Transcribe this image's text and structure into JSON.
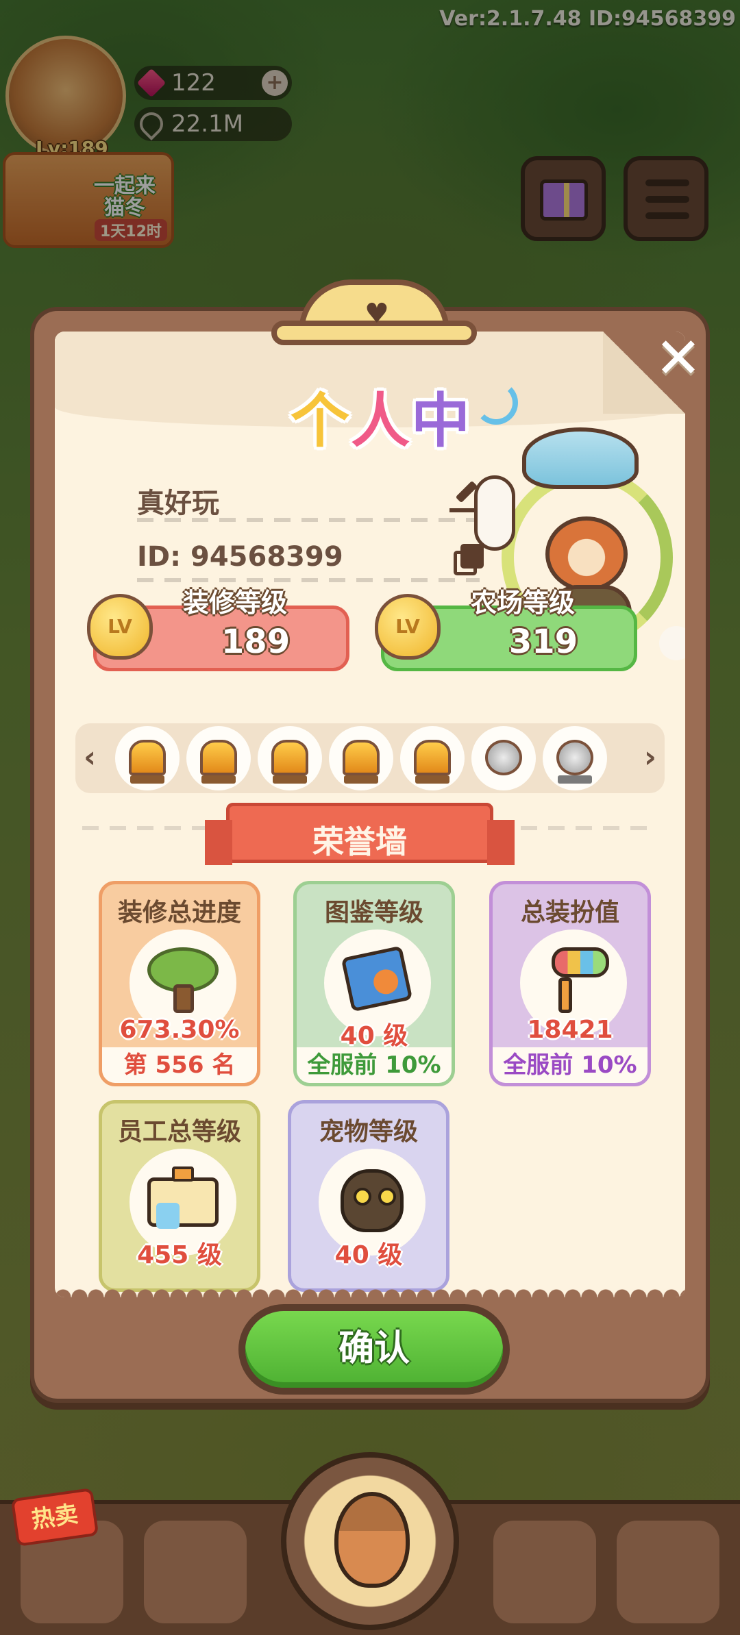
{
  "version_text": "Ver:2.1.7.48 ID:94568399",
  "hud": {
    "level": "Lv:189",
    "gems": "122",
    "coins": "22.1M",
    "plus": "+",
    "event_title": "一起来\n猫冬",
    "event_time": "1天12时"
  },
  "modal": {
    "title_chars": [
      "个",
      "人",
      "中"
    ],
    "close_symbol": "✕",
    "nickname": "真好玩",
    "id_text": "ID: 94568399",
    "decor_level_label": "装修等级",
    "decor_level_value": "189",
    "farm_level_label": "农场等级",
    "farm_level_value": "319",
    "lv_badge": "LV",
    "arrow_left": "‹",
    "arrow_right": "›",
    "honor_wall": "荣誉墙",
    "stats": [
      {
        "title": "装修总进度",
        "value": "673.30%",
        "footer": "第 556 名"
      },
      {
        "title": "图鉴等级",
        "value": "40 级",
        "footer": "全服前 10%"
      },
      {
        "title": "总装扮值",
        "value": "18421",
        "footer": "全服前 10%"
      },
      {
        "title": "员工总等级",
        "value": "455 级",
        "footer": ""
      },
      {
        "title": "宠物等级",
        "value": "40 级",
        "footer": ""
      }
    ],
    "confirm_label": "确认"
  },
  "bottom_nav": {
    "hot_sale": "热卖"
  }
}
